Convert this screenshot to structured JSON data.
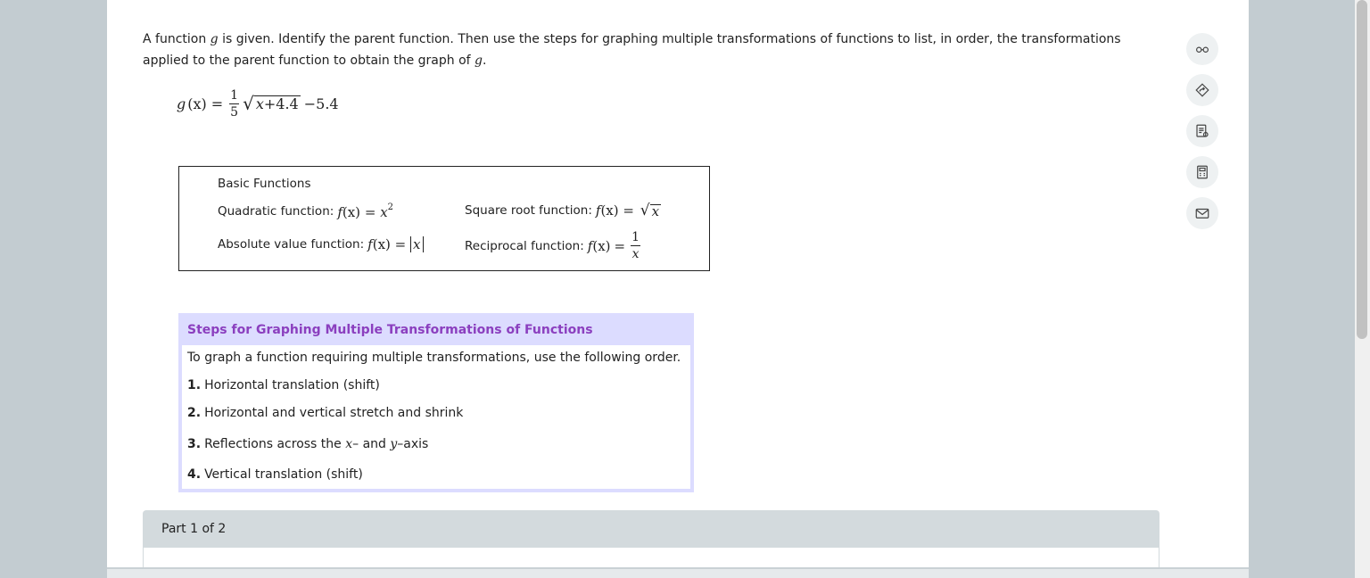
{
  "prompt": {
    "line1_a": "A function ",
    "line1_var": "g",
    "line1_b": " is given. Identify the parent function. Then use the steps for graphing multiple transformations of functions to list, in order, the transformations",
    "line2_a": "applied to the parent function to obtain the graph of ",
    "line2_var": "g",
    "line2_b": "."
  },
  "equation": {
    "lhs": "g",
    "arg": "(x)",
    "eq": "=",
    "frac_num": "1",
    "frac_den": "5",
    "radicand_var": "x",
    "radicand_rest": "+4.4",
    "tail": "−5.4"
  },
  "basic_functions": {
    "title": "Basic Functions",
    "quadratic_label": "Quadratic function:",
    "quadratic_f": "f",
    "quadratic_arg": "(x)",
    "quadratic_eq": "=",
    "quadratic_base": "x",
    "quadratic_exp": "2",
    "sqrt_label": "Square root function:",
    "sqrt_f": "f",
    "sqrt_arg": "(x)",
    "sqrt_eq": "=",
    "sqrt_var": "x",
    "abs_label": "Absolute value function:",
    "abs_f": "f",
    "abs_arg": "(x)",
    "abs_eq": "=",
    "abs_var": "x",
    "recip_label": "Reciprocal function:",
    "recip_f": "f",
    "recip_arg": "(x)",
    "recip_eq": "=",
    "recip_num": "1",
    "recip_den": "x"
  },
  "steps": {
    "title": "Steps for Graphing Multiple Transformations of Functions",
    "intro": "To graph a function requiring multiple transformations, use the following order.",
    "items": [
      {
        "num": "1.",
        "text": "Horizontal translation (shift)"
      },
      {
        "num": "2.",
        "text": "Horizontal and vertical stretch and shrink"
      },
      {
        "num": "3.",
        "text_a": "Reflections across the ",
        "var1": "x",
        "text_b": "– and ",
        "var2": "y",
        "text_c": "–axis"
      },
      {
        "num": "4.",
        "text": "Vertical translation (shift)"
      }
    ]
  },
  "part": {
    "label": "Part 1 of 2"
  },
  "tools": [
    "glasses-icon",
    "compass-icon",
    "notes-icon",
    "calculator-icon",
    "mail-icon"
  ]
}
